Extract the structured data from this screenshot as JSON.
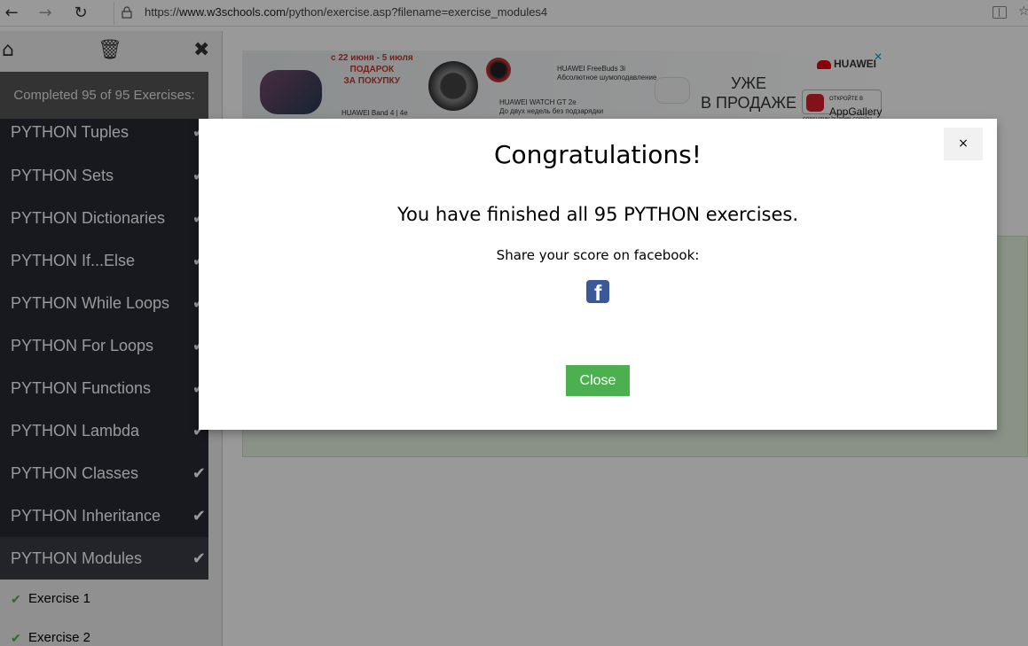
{
  "browser": {
    "url_prefix": "https://",
    "url_host": "www.w3schools.com",
    "url_path": "/python/exercise.asp?filename=exercise_modules4",
    "back_glyph": "←",
    "forward_glyph": "→",
    "reload_glyph": "↻",
    "star_glyph": "☆"
  },
  "sidebar": {
    "icons": {
      "home": "home-icon",
      "trash": "trash-icon",
      "close": "close-icon"
    },
    "home_glyph": "⌂",
    "trash_glyph": "🗑",
    "close_glyph": "✖",
    "completed_text": "Completed 95 of 95 Exercises:",
    "check_glyph": "✔",
    "items": [
      {
        "label": "PYTHON Tuples"
      },
      {
        "label": "PYTHON Sets"
      },
      {
        "label": "PYTHON Dictionaries"
      },
      {
        "label": "PYTHON If...Else"
      },
      {
        "label": "PYTHON While Loops"
      },
      {
        "label": "PYTHON For Loops"
      },
      {
        "label": "PYTHON Functions"
      },
      {
        "label": "PYTHON Lambda"
      },
      {
        "label": "PYTHON Classes"
      },
      {
        "label": "PYTHON Inheritance"
      },
      {
        "label": "PYTHON Modules"
      }
    ],
    "sub_items": [
      {
        "label": "Exercise 1"
      },
      {
        "label": "Exercise 2"
      }
    ]
  },
  "ad": {
    "close_glyph": "✕",
    "promo": "с 22 июня - 5 июля\nПОДАРОК\nЗА ПОКУПКУ",
    "product_buds": "HUAWEI FreeBuds 3i\nАбсолютное шумоподавление",
    "product_watch": "HUAWEI WATCH GT 2e\nДо двух недель без подзарядки",
    "product_band": "HUAWEI Band 4 | 4e",
    "slogan": "УЖЕ\nВ ПРОДАЖЕ",
    "brand": "HUAWEI",
    "appgallery_small": "ОТКРОЙТЕ В",
    "appgallery": "AppGallery",
    "site": "consumer.huawei.com/ru"
  },
  "modal": {
    "close_glyph": "×",
    "title": "Congratulations!",
    "message": "You have finished all 95 PYTHON exercises.",
    "share_text": "Share your score on facebook:",
    "facebook_glyph": "f",
    "close_button": "Close"
  },
  "colors": {
    "sidebar_dark": "#282a35",
    "accent_green": "#4caf50",
    "facebook_blue": "#3b5998"
  }
}
